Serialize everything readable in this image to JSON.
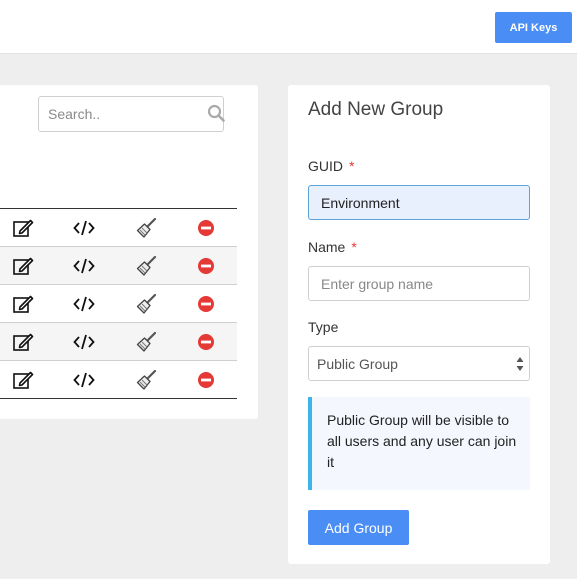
{
  "header": {
    "api_keys_label": "API Keys"
  },
  "groups_list": {
    "search_placeholder": "Search..",
    "rows": [
      {
        "actions": [
          "edit-icon",
          "code-icon",
          "brush-icon",
          "remove-icon"
        ]
      },
      {
        "actions": [
          "edit-icon",
          "code-icon",
          "brush-icon",
          "remove-icon"
        ]
      },
      {
        "actions": [
          "edit-icon",
          "code-icon",
          "brush-icon",
          "remove-icon"
        ]
      },
      {
        "actions": [
          "edit-icon",
          "code-icon",
          "brush-icon",
          "remove-icon"
        ]
      },
      {
        "actions": [
          "edit-icon",
          "code-icon",
          "brush-icon",
          "remove-icon"
        ]
      }
    ]
  },
  "add_group_form": {
    "title": "Add New Group",
    "guid_label": "GUID",
    "guid_value": "Environment",
    "name_label": "Name",
    "name_placeholder": "Enter group name",
    "required_marker": "*",
    "type_label": "Type",
    "type_selected": "Public Group",
    "info_text": "Public Group will be visible to all users and any user can join it",
    "submit_label": "Add Group"
  },
  "colors": {
    "primary": "#4a8ef5",
    "danger": "#e53935",
    "info_accent": "#3cb6e8",
    "background": "#eeeeee"
  }
}
